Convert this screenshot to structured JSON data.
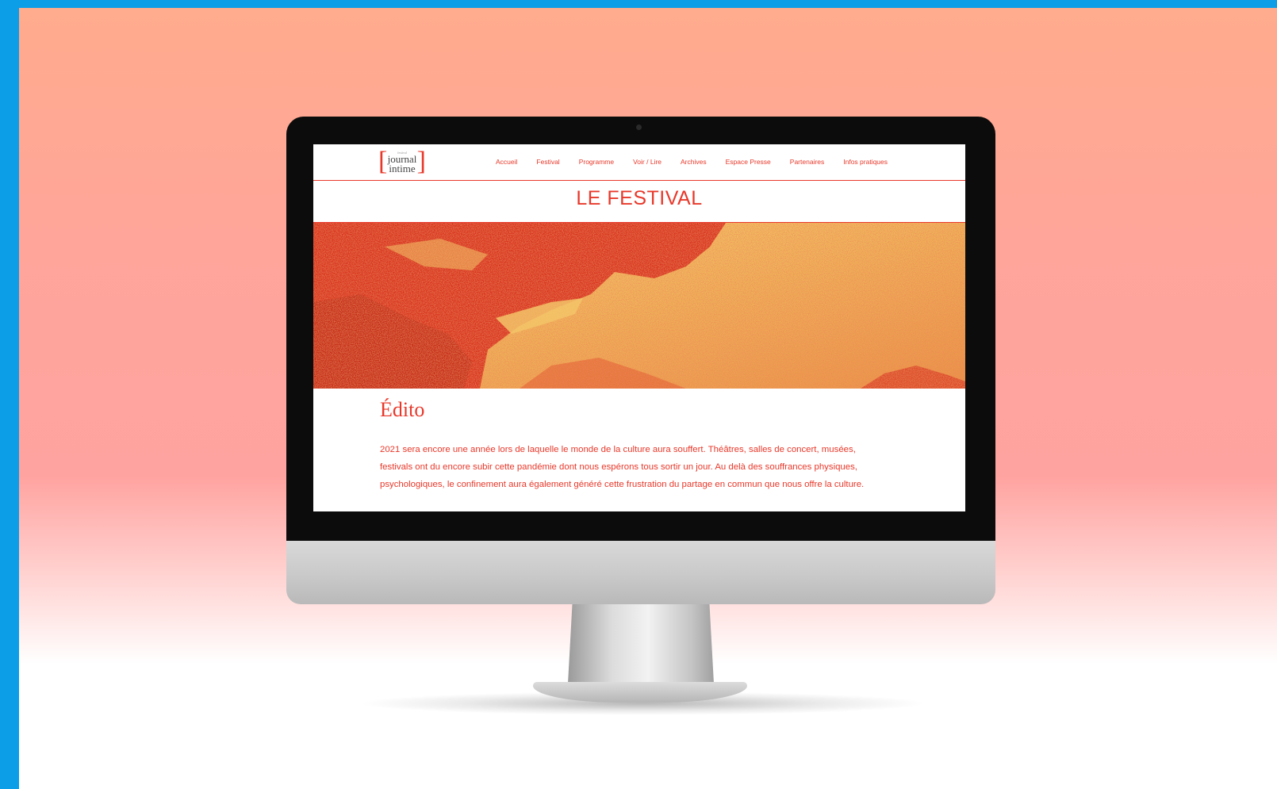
{
  "logo": {
    "small": "festival",
    "line1": "journal",
    "line2": "intime",
    "open": "[",
    "close": "]"
  },
  "nav": [
    {
      "label": "Accueil"
    },
    {
      "label": "Festival"
    },
    {
      "label": "Programme"
    },
    {
      "label": "Voir / Lire"
    },
    {
      "label": "Archives"
    },
    {
      "label": "Espace Presse"
    },
    {
      "label": "Partenaires"
    },
    {
      "label": "Infos pratiques"
    }
  ],
  "page": {
    "title": "LE FESTIVAL",
    "edito_heading": "Édito",
    "edito_text": "2021 sera encore une année lors de laquelle le monde de la culture aura souffert. Théâtres, salles de concert, musées, festivals ont du encore subir cette pandémie dont nous espérons tous sortir un jour. Au delà des souffrances physiques, psychologiques, le confinement aura également généré cette frustration du partage en commun que nous offre la culture."
  },
  "colors": {
    "brand": "#e8382a",
    "frame": "#0c9ee6",
    "hero_light": "#f5c86a",
    "hero_dark": "#d8321e"
  }
}
